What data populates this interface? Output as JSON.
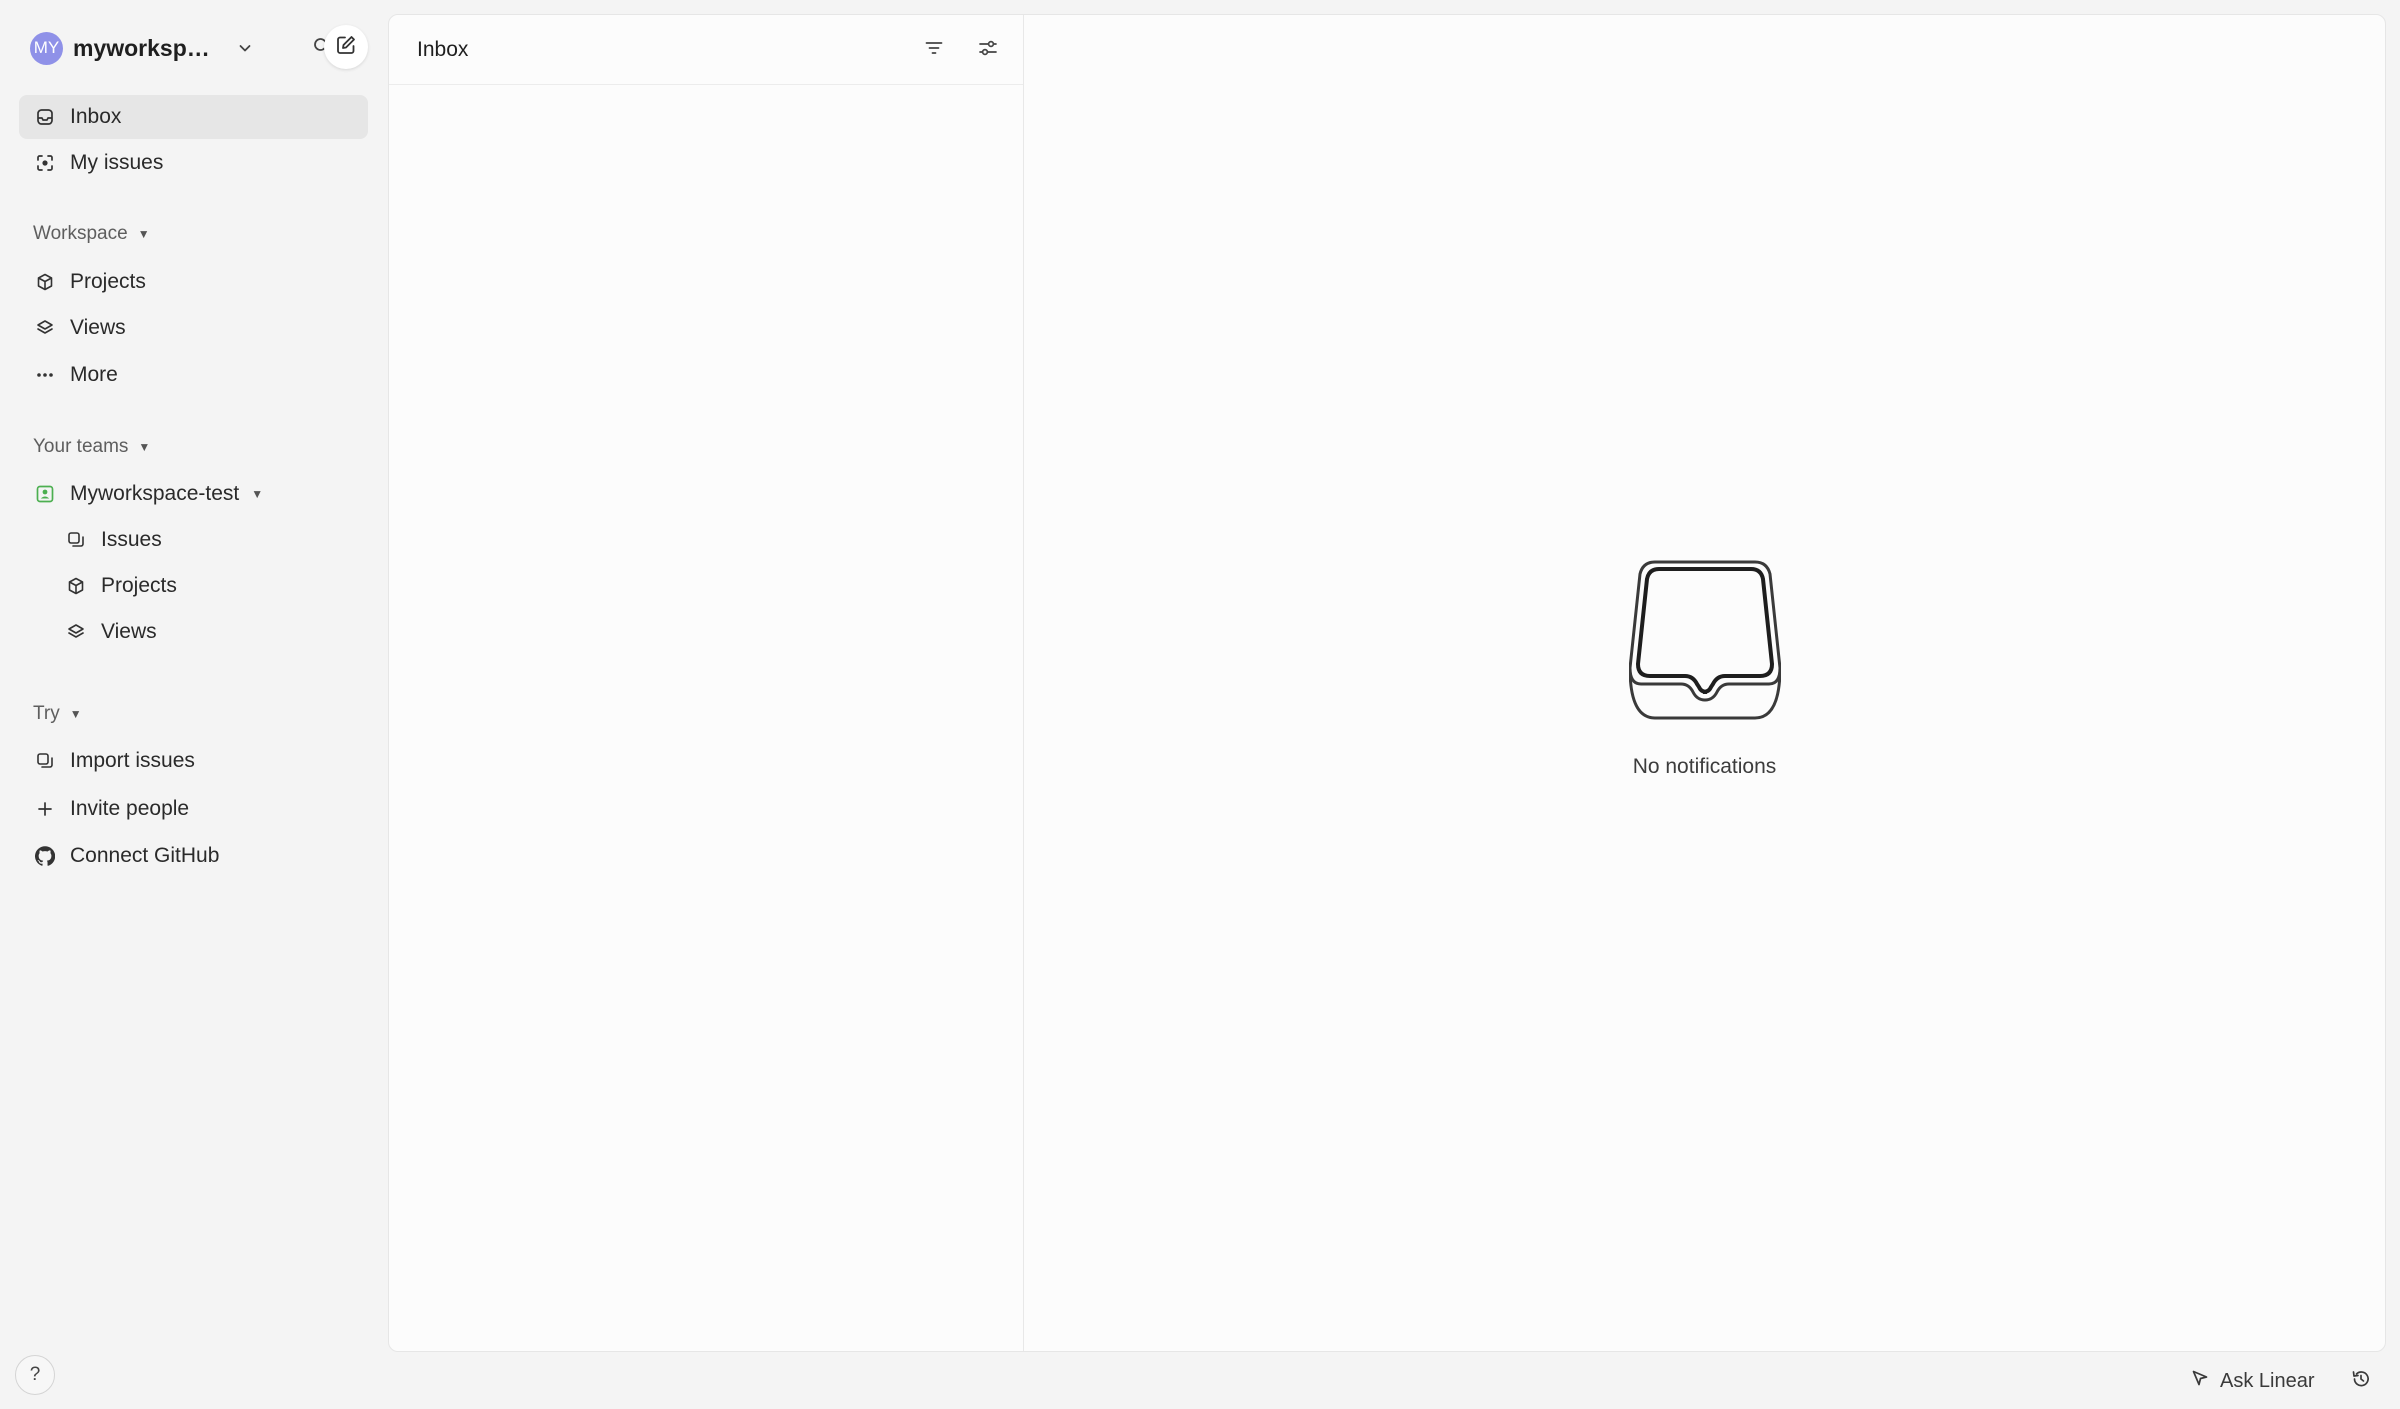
{
  "workspace": {
    "avatar_initials": "MY",
    "name": "myworkspac...",
    "avatar_color": "#8f91e8"
  },
  "nav": {
    "inbox": "Inbox",
    "my_issues": "My issues"
  },
  "sections": {
    "workspace": {
      "label": "Workspace",
      "items": [
        "Projects",
        "Views",
        "More"
      ]
    },
    "your_teams": {
      "label": "Your teams",
      "team": {
        "name": "Myworkspace-test",
        "icon_color": "#4caf50",
        "items": [
          "Issues",
          "Projects",
          "Views"
        ]
      }
    },
    "try": {
      "label": "Try",
      "items": [
        "Import issues",
        "Invite people",
        "Connect GitHub"
      ]
    }
  },
  "list_pane": {
    "title": "Inbox"
  },
  "detail_pane": {
    "empty_text": "No notifications"
  },
  "help_label": "?",
  "bottom_bar": {
    "ask_label": "Ask Linear"
  }
}
